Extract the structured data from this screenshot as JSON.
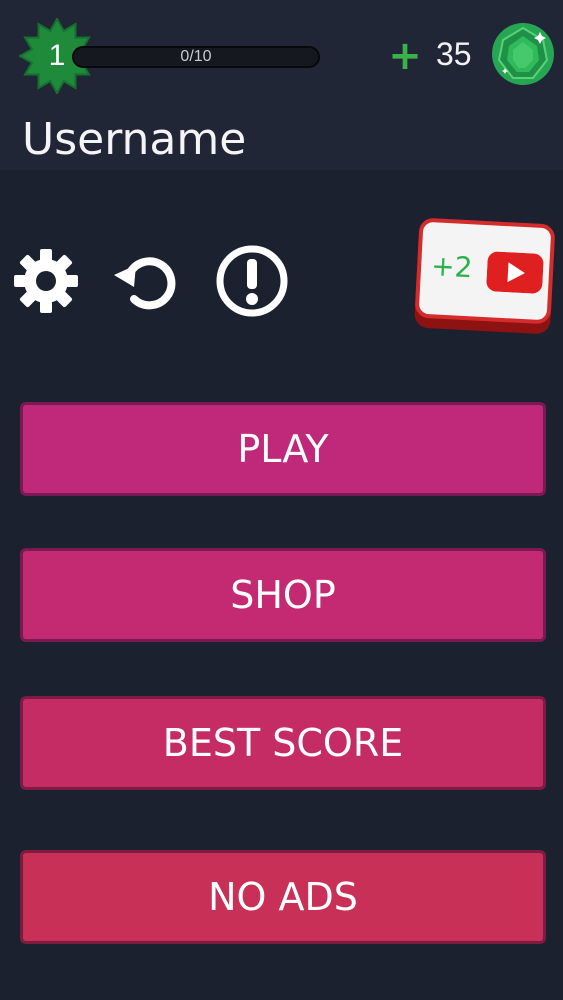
{
  "player": {
    "level": "1",
    "xp_text": "0/10",
    "xp_progress": 0,
    "username": "Username"
  },
  "currency": {
    "add_label": "+",
    "gems": "35",
    "icon": "emerald-gem-icon"
  },
  "toolbar": {
    "icons": [
      "gear-icon",
      "restart-icon",
      "alert-icon"
    ]
  },
  "video_reward": {
    "label": "+2",
    "icon": "youtube-play-icon"
  },
  "menu": {
    "play": "PLAY",
    "shop": "SHOP",
    "best_score": "BEST SCORE",
    "no_ads": "NO ADS"
  },
  "colors": {
    "background": "#1c2130",
    "header": "#212636",
    "level_star": "#1f8a3a",
    "button_play": "#c0287a",
    "button_shop": "#c42a72",
    "button_best": "#c62c64",
    "button_noads": "#c83057",
    "accent_green": "#38b249"
  }
}
